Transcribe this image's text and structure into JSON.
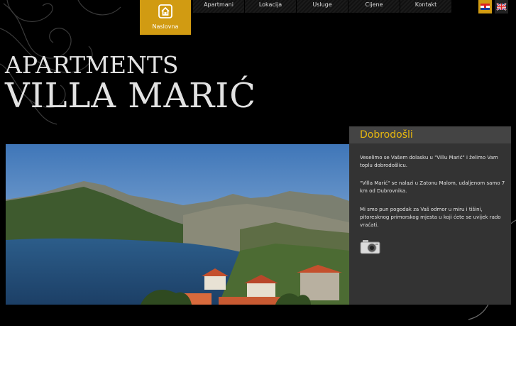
{
  "nav": {
    "home_label": "Naslovna",
    "items": [
      "Apartmani",
      "Lokacija",
      "Usluge",
      "Cijene",
      "Kontakt"
    ]
  },
  "flags": [
    "croatian-flag",
    "uk-flag"
  ],
  "logo": {
    "line1": "APARTMENTS",
    "line2": "VILLA MARIĆ"
  },
  "welcome": {
    "title": "Dobrodošli",
    "paragraphs": [
      "Veselimo se Vašem dolasku u \"Villu Marić\" i želimo Vam toplu dobrodošlicu.",
      "\"Villa Marić\" se nalazi u Zatonu Malom, udaljenom samo 7 km od Dubrovnika.",
      "Mi smo pun pogodak za Vaš odmor u miru i tišini, pitoresknog primorskog mjesta u koji ćete se uvijek rado vraćati."
    ]
  },
  "colors": {
    "accent": "#d19b12",
    "title": "#e8b80f",
    "panel": "#333333",
    "background": "#000000"
  }
}
